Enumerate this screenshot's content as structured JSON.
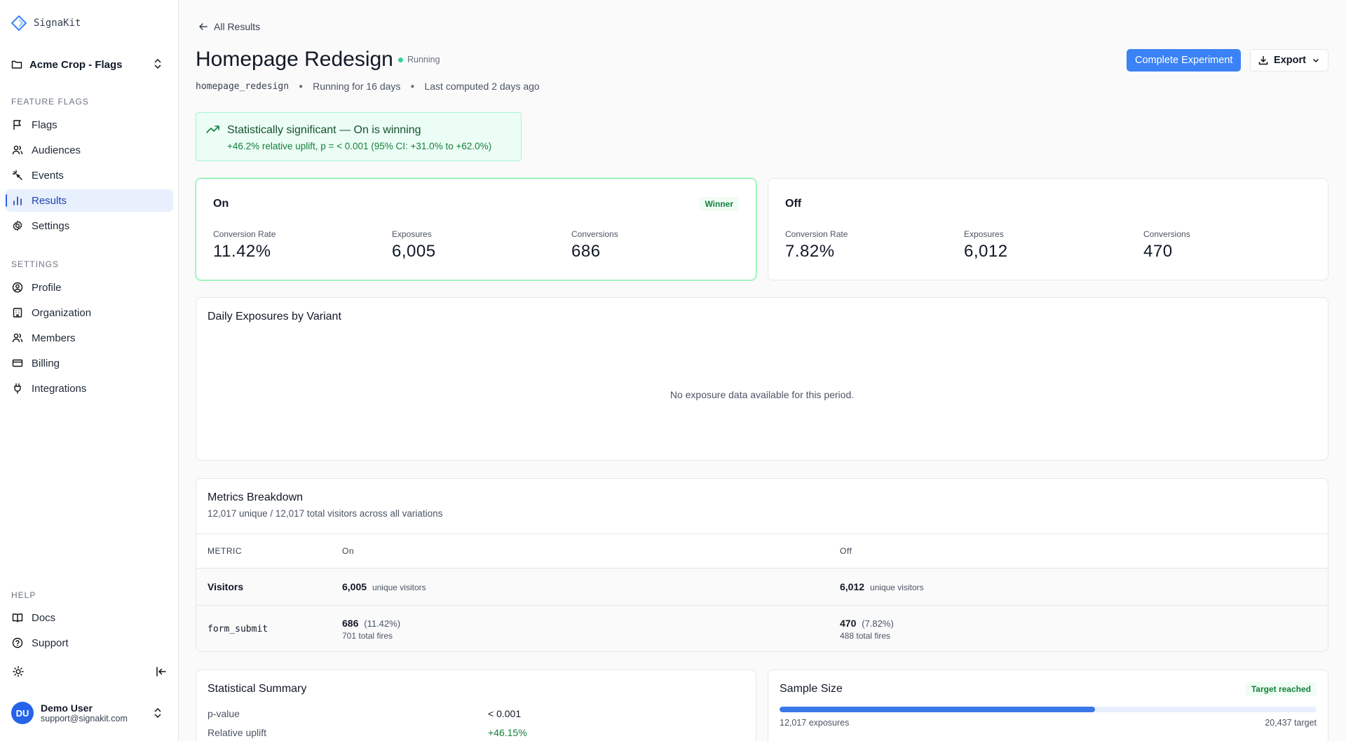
{
  "app": {
    "brand": "SignaKit",
    "org": "Acme Crop - Flags"
  },
  "sidebar": {
    "feature_flags_label": "FEATURE FLAGS",
    "feature_items": [
      {
        "label": "Flags",
        "icon": "flag-icon"
      },
      {
        "label": "Audiences",
        "icon": "users-icon"
      },
      {
        "label": "Events",
        "icon": "sparkle-icon"
      },
      {
        "label": "Results",
        "icon": "bar-chart-icon",
        "active": true
      },
      {
        "label": "Settings",
        "icon": "gear-icon"
      }
    ],
    "settings_label": "SETTINGS",
    "settings_items": [
      {
        "label": "Profile",
        "icon": "user-circle-icon"
      },
      {
        "label": "Organization",
        "icon": "building-icon"
      },
      {
        "label": "Members",
        "icon": "users-icon"
      },
      {
        "label": "Billing",
        "icon": "credit-card-icon"
      },
      {
        "label": "Integrations",
        "icon": "plug-icon"
      }
    ],
    "help_label": "HELP",
    "help_items": [
      {
        "label": "Docs",
        "icon": "book-icon"
      },
      {
        "label": "Support",
        "icon": "help-circle-icon"
      }
    ],
    "user": {
      "initials": "DU",
      "name": "Demo User",
      "email": "support@signakit.com"
    }
  },
  "header": {
    "back_label": "All Results",
    "title": "Homepage Redesign",
    "status": "Running",
    "key": "homepage_redesign",
    "running_for": "Running for 16 days",
    "last_computed": "Last computed 2 days ago",
    "complete_button": "Complete Experiment",
    "export_button": "Export"
  },
  "significance": {
    "title": "Statistically significant — On is winning",
    "detail": "+46.2% relative uplift, p = < 0.001 (95% CI: +31.0% to +62.0%)"
  },
  "variants": {
    "on": {
      "name": "On",
      "badge": "Winner",
      "conversion_rate_label": "Conversion Rate",
      "conversion_rate": "11.42%",
      "exposures_label": "Exposures",
      "exposures": "6,005",
      "conversions_label": "Conversions",
      "conversions": "686"
    },
    "off": {
      "name": "Off",
      "conversion_rate_label": "Conversion Rate",
      "conversion_rate": "7.82%",
      "exposures_label": "Exposures",
      "exposures": "6,012",
      "conversions_label": "Conversions",
      "conversions": "470"
    }
  },
  "daily_exposures": {
    "title": "Daily Exposures by Variant",
    "empty": "No exposure data available for this period."
  },
  "metrics": {
    "title": "Metrics Breakdown",
    "subtitle": "12,017 unique / 12,017 total visitors across all variations",
    "headers": [
      "METRIC",
      "On",
      "Off"
    ],
    "visitors": {
      "label": "Visitors",
      "on": "6,005",
      "off": "6,012",
      "unit": "unique visitors"
    },
    "form_submit": {
      "label": "form_submit",
      "on": "686",
      "on_pct": "(11.42%)",
      "on_fires": "701 total fires",
      "off": "470",
      "off_pct": "(7.82%)",
      "off_fires": "488 total fires"
    }
  },
  "stat_summary": {
    "title": "Statistical Summary",
    "pvalue_label": "p-value",
    "pvalue": "< 0.001",
    "uplift_label": "Relative uplift",
    "uplift": "+46.15%"
  },
  "sample_size": {
    "title": "Sample Size",
    "badge": "Target reached",
    "exposures": "12,017 exposures",
    "target": "20,437 target",
    "progress_fraction": 0.588
  }
}
